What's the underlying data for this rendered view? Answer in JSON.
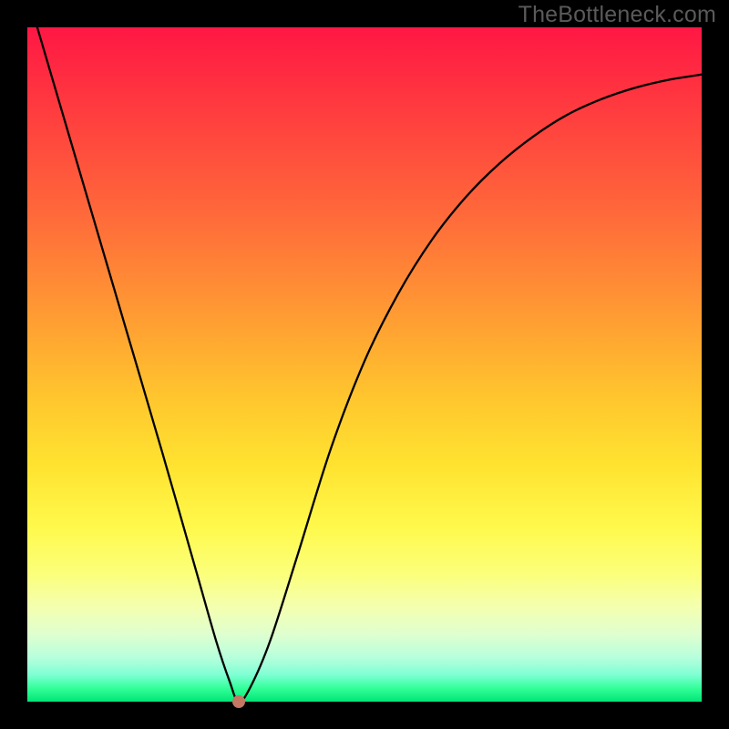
{
  "watermark": "TheBottleneck.com",
  "chart_data": {
    "type": "line",
    "title": "",
    "xlabel": "",
    "ylabel": "",
    "xlim": [
      0,
      1
    ],
    "ylim": [
      0,
      1
    ],
    "series": [
      {
        "name": "bottleneck-curve",
        "x": [
          0.0,
          0.05,
          0.1,
          0.15,
          0.2,
          0.25,
          0.28,
          0.3,
          0.313,
          0.33,
          0.36,
          0.4,
          0.45,
          0.5,
          0.55,
          0.6,
          0.65,
          0.7,
          0.75,
          0.8,
          0.85,
          0.9,
          0.95,
          1.0
        ],
        "y": [
          1.05,
          0.88,
          0.71,
          0.54,
          0.37,
          0.195,
          0.09,
          0.03,
          0.0,
          0.02,
          0.09,
          0.215,
          0.375,
          0.505,
          0.605,
          0.685,
          0.748,
          0.798,
          0.838,
          0.87,
          0.893,
          0.91,
          0.922,
          0.93
        ]
      }
    ],
    "marker": {
      "x": 0.313,
      "y": 0.0
    },
    "background_gradient": {
      "top_color": "#ff1744",
      "bottom_color": "#00e676"
    }
  }
}
